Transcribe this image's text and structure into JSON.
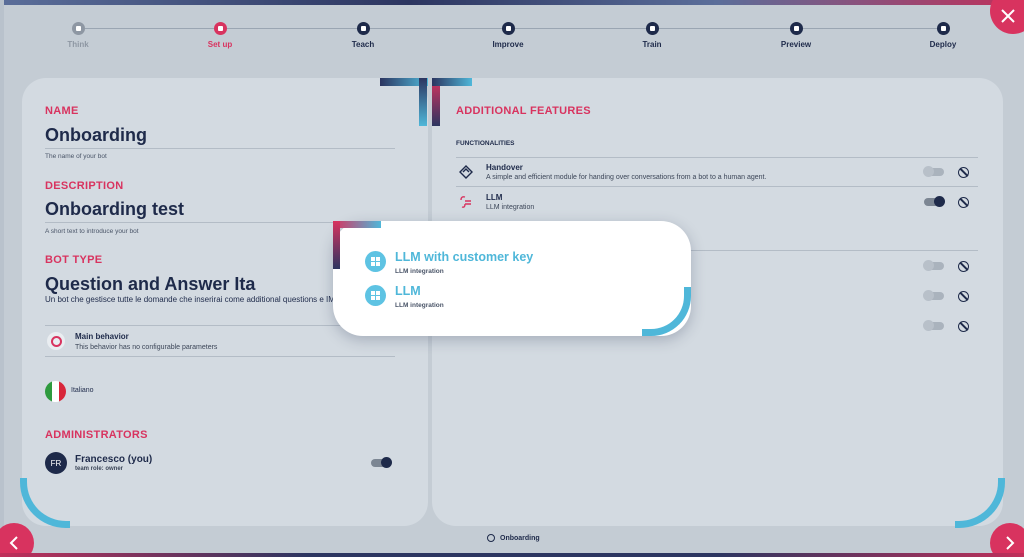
{
  "stepper": {
    "steps": [
      {
        "label": "Think",
        "state": "done"
      },
      {
        "label": "Set up",
        "state": "active"
      },
      {
        "label": "Teach",
        "state": "todo"
      },
      {
        "label": "Improve",
        "state": "todo"
      },
      {
        "label": "Train",
        "state": "todo"
      },
      {
        "label": "Preview",
        "state": "todo"
      },
      {
        "label": "Deploy",
        "state": "todo"
      }
    ]
  },
  "bot": {
    "name_heading": "NAME",
    "name_value": "Onboarding",
    "name_hint": "The name of your bot",
    "description_heading": "DESCRIPTION",
    "description_value": "Onboarding test",
    "description_hint": "A short text to introduce your bot",
    "type_heading": "BOT TYPE",
    "type_value": "Question and Answer Ita",
    "type_desc": "Un bot che gestisce tutte le domande che inserirai come additional questions e IMPROVE.",
    "behavior_title": "Main behavior",
    "behavior_desc": "This behavior has no configurable parameters",
    "language": "Italiano",
    "flag_colors": [
      "#2e9a3e",
      "#ffffff",
      "#d8263a"
    ]
  },
  "administrators": {
    "heading": "ADMINISTRATORS",
    "avatar_initials": "FR",
    "name": "Francesco (you)",
    "role": "team role: owner"
  },
  "features": {
    "heading": "ADDITIONAL FEATURES",
    "subheading": "FUNCTIONALITIES",
    "items": [
      {
        "title": "Handover",
        "desc": "A simple and efficient module for handing over conversations from a bot to a human agent.",
        "enabled": false
      },
      {
        "title": "LLM",
        "desc": "LLM integration",
        "enabled": true
      }
    ],
    "hidden_toggles": [
      false,
      false,
      false
    ]
  },
  "modal": {
    "options": [
      {
        "title": "LLM with customer key",
        "sub": "LLM integration"
      },
      {
        "title": "LLM",
        "sub": "LLM integration"
      }
    ]
  },
  "footer": {
    "bot_name": "Onboarding"
  },
  "colors": {
    "accent": "#d8335f",
    "primary": "#1e2a4a",
    "highlight": "#4fb7d9"
  }
}
